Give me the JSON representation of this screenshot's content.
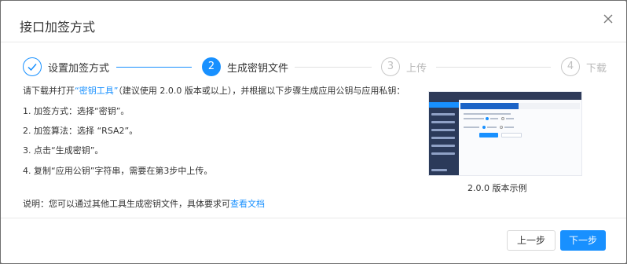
{
  "dialog": {
    "title": "接口加签方式",
    "close_icon": "close-icon"
  },
  "steps": [
    {
      "number": "",
      "label": "设置加签方式",
      "status": "done",
      "icon": "check-icon"
    },
    {
      "number": "2",
      "label": "生成密钥文件",
      "status": "active"
    },
    {
      "number": "3",
      "label": "上传",
      "status": "wait"
    },
    {
      "number": "4",
      "label": "下载",
      "status": "wait"
    }
  ],
  "instructions": {
    "intro_prefix": "请下载并打开",
    "intro_link": "“密钥工具”",
    "intro_suffix": "（建议使用 2.0.0 版本或以上），并根据以下步骤生成应用公钥与应用私钥：",
    "items": [
      "1. 加签方式：选择“密钥”。",
      "2. 加签算法：选择 “RSA2”。",
      "3. 点击“生成密钥”。",
      "4. 复制“应用公钥”字符串，需要在第3步中上传。"
    ],
    "note_prefix": "说明：您可以通过其他工具生成密钥文件，具体要求可",
    "note_link": "查看文档"
  },
  "preview": {
    "caption": "2.0.0 版本示例"
  },
  "footer": {
    "prev_label": "上一步",
    "next_label": "下一步"
  },
  "colors": {
    "primary": "#1890ff",
    "text": "#333333",
    "wait": "#b8b8b8"
  }
}
